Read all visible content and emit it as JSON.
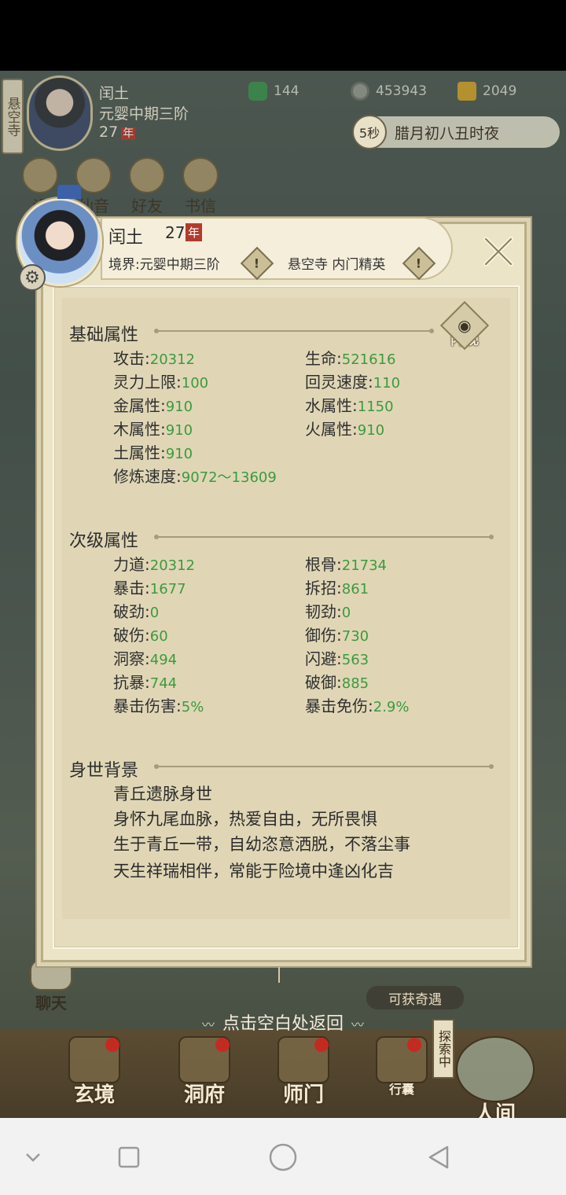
{
  "hud": {
    "side_tag": "悬空寺",
    "name": "闰土",
    "realm": "元婴中期三阶",
    "age": "27",
    "age_tag": "年",
    "resources": {
      "jade": "144",
      "coin": "453943",
      "gold": "2049"
    },
    "time_seconds": "5秒",
    "time_text": "腊月初八丑时夜",
    "icons": [
      "设",
      "仙音",
      "好友",
      "书信"
    ]
  },
  "dialog": {
    "name": "闰土",
    "age": "27",
    "age_tag": "年",
    "realm": "境界:元婴中期三阶",
    "sect": "悬空寺 内门精英",
    "warn_glyph": "!",
    "eye_label": "内视",
    "sections": {
      "basic": {
        "title": "基础属性",
        "attrs": [
          {
            "label": "攻击:",
            "value": "20312"
          },
          {
            "label": "生命:",
            "value": "521616"
          },
          {
            "label": "灵力上限:",
            "value": "100"
          },
          {
            "label": "回灵速度:",
            "value": "110"
          },
          {
            "label": "金属性:",
            "value": "910"
          },
          {
            "label": "水属性:",
            "value": "1150"
          },
          {
            "label": "木属性:",
            "value": "910"
          },
          {
            "label": "火属性:",
            "value": "910"
          },
          {
            "label": "土属性:",
            "value": "910"
          },
          {
            "label": "修炼速度:",
            "value": "9072～13609"
          }
        ]
      },
      "secondary": {
        "title": "次级属性",
        "attrs": [
          {
            "label": "力道:",
            "value": "20312"
          },
          {
            "label": "根骨:",
            "value": "21734"
          },
          {
            "label": "暴击:",
            "value": "1677"
          },
          {
            "label": "拆招:",
            "value": "861"
          },
          {
            "label": "破劲:",
            "value": "0"
          },
          {
            "label": "韧劲:",
            "value": "0"
          },
          {
            "label": "破伤:",
            "value": "60"
          },
          {
            "label": "御伤:",
            "value": "730"
          },
          {
            "label": "洞察:",
            "value": "494"
          },
          {
            "label": "闪避:",
            "value": "563"
          },
          {
            "label": "抗暴:",
            "value": "744"
          },
          {
            "label": "破御:",
            "value": "885"
          },
          {
            "label": "暴击伤害:",
            "value": "5%"
          },
          {
            "label": "暴击免伤:",
            "value": "2.9%"
          }
        ]
      },
      "background": {
        "title": "身世背景",
        "lines": [
          "青丘遗脉身世",
          "身怀九尾血脉，热爱自由，无所畏惧",
          "生于青丘一带，自幼恣意洒脱，不落尘事",
          "天生祥瑞相伴，常能于险境中逢凶化吉"
        ]
      }
    }
  },
  "bottom": {
    "chat": "聊天",
    "encounter": "可获奇遇",
    "return_hint": "点击空白处返回",
    "explore_tag": "探索中",
    "nav": [
      "玄境",
      "洞府",
      "师门",
      "行囊",
      "人间"
    ]
  },
  "colors": {
    "value_green": "#3a9b3d",
    "panel": "#e0d6b6",
    "badge_red": "#b33a2d"
  }
}
